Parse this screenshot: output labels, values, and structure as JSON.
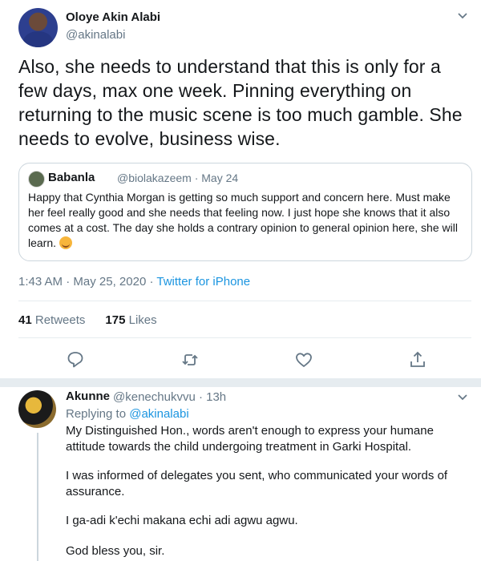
{
  "tweet": {
    "author_name": "Oloye Akin Alabi",
    "author_handle": "@akinalabi",
    "text": "Also, she needs to understand that this is only for a few days, max one week. Pinning everything on returning to the music scene is too much gamble. She needs to evolve, business wise.",
    "quote": {
      "author_name": "Babanla",
      "author_handle": "@biolakazeem",
      "date": "May 24",
      "text": "Happy that Cynthia Morgan is getting so much support and concern here. Must make her feel really good and she needs that feeling now. I just hope she knows that it also comes at a cost. The day she holds a contrary opinion to general opinion here, she will learn."
    },
    "time": "1:43 AM",
    "date": "May 25, 2020",
    "source": "Twitter for iPhone",
    "retweets_count": "41",
    "retweets_label": "Retweets",
    "likes_count": "175",
    "likes_label": "Likes"
  },
  "reply": {
    "author_name": "Akunne",
    "author_handle": "@kenechukvvu",
    "age": "13h",
    "replying_to_label": "Replying to",
    "replying_to_handle": "@akinalabi",
    "paragraphs": [
      "My Distinguished Hon., words aren't enough to express your humane attitude towards the child undergoing treatment in Garki Hospital.",
      "I was informed of delegates you sent, who communicated your words of assurance.",
      "I ga-adi k'echi makana echi adi agwu agwu.",
      "God bless you, sir."
    ]
  },
  "colors": {
    "text": "#14171a",
    "secondary": "#657786",
    "link": "#1b95e0",
    "divider": "#e6ecf0"
  },
  "icons": [
    "chevron-down-icon",
    "reply-icon",
    "retweet-icon",
    "like-icon",
    "share-icon",
    "smiling-emoji-icon"
  ]
}
